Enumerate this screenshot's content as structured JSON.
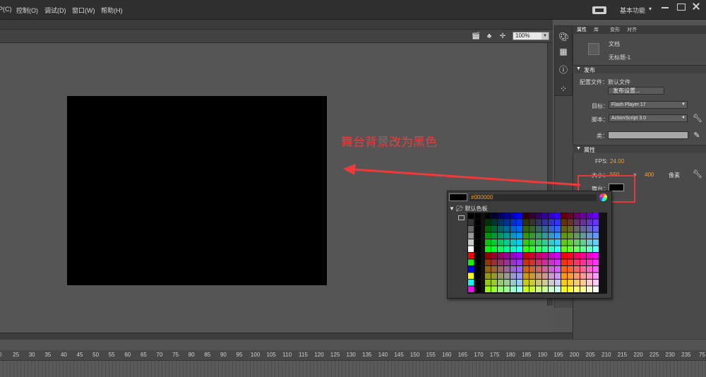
{
  "menu": {
    "items": [
      "P(C)",
      "控制(O)",
      "调试(D)",
      "窗口(W)",
      "帮助(H)"
    ]
  },
  "workspace": {
    "label": "基本功能",
    "caret": "▾"
  },
  "editbar": {
    "zoom": "100%"
  },
  "annotation": {
    "text": "舞台背景改为黑色"
  },
  "properties": {
    "tabs": [
      "属性",
      "库",
      "变形",
      "对齐"
    ],
    "doc_type": "文档",
    "doc_name": "无标题-1",
    "publish": {
      "header": "发布",
      "profile_label": "配置文件：",
      "profile_value": "默认文件",
      "settings_button": "发布设置...",
      "target_label": "目标：",
      "target_value": "Flash Player 17",
      "script_label": "脚本：",
      "script_value": "ActionScript 3.0",
      "class_label": "类："
    },
    "attrs": {
      "header": "属性",
      "fps_label": "FPS:",
      "fps_value": "24.00",
      "size_label": "大小：",
      "width": "550",
      "x_mark": "×",
      "height": "400",
      "unit": "像素",
      "stage_label": "舞台："
    }
  },
  "swatch_popup": {
    "hex": "#000000",
    "tree_label": "默认色板",
    "stage_color": "#000000"
  },
  "timeline": {
    "ticks": [
      "0",
      "25",
      "30",
      "35",
      "40",
      "45",
      "50",
      "55",
      "60",
      "65",
      "70",
      "75",
      "80",
      "85",
      "90",
      "95",
      "100",
      "105",
      "110",
      "115",
      "120",
      "125",
      "130",
      "135",
      "140",
      "145",
      "150",
      "155",
      "160",
      "165",
      "170",
      "175",
      "180",
      "185",
      "190",
      "195",
      "200",
      "205",
      "210",
      "215",
      "220",
      "225",
      "230",
      "235",
      "75"
    ]
  },
  "colors": {
    "annotation_red": "#f03a3a",
    "value_orange": "#e8a33a",
    "stage_black": "#000000"
  }
}
